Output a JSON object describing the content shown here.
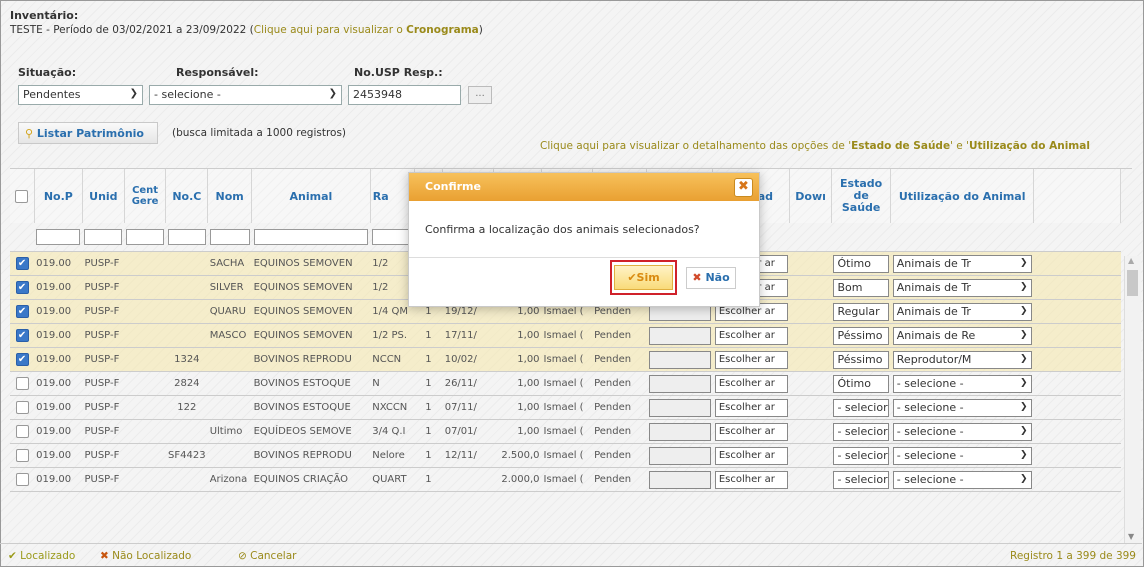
{
  "header": {
    "title": "Inventário:",
    "period_text": "TESTE - Período de 03/02/2021 a 23/09/2022 (",
    "cronograma_prefix": "Clique aqui para visualizar o ",
    "cronograma_link": "Cronograma",
    "period_close": ")"
  },
  "filters": {
    "situacao_label": "Situação:",
    "situacao_value": "Pendentes",
    "responsavel_label": "Responsável:",
    "responsavel_value": "- selecione -",
    "nousp_label": "No.USP Resp.:",
    "nousp_value": "2453948",
    "dots_label": "..."
  },
  "toolbar": {
    "list_button": "Listar Patrimônio",
    "limit_note": "(busca limitada a 1000 registros)",
    "hint_prefix": "Clique aqui para visualizar o detalhamento das opções de '",
    "hint_estado": "Estado de Saúde",
    "hint_mid": "' e '",
    "hint_util": "Utilização do Animal"
  },
  "table": {
    "headers": {
      "nop": "No.P",
      "unid": "Unid",
      "cent": "Cent Gere",
      "noc": "No.C",
      "nom": "Nom",
      "animal": "Animal",
      "ra": "Ra",
      "upload": "Upload",
      "down": "Dowı",
      "estado": "Estado de Saúde",
      "util": "Utilização do Animal"
    },
    "upload_label": "Escolher ar",
    "rows": [
      {
        "nop": "019.00",
        "unid": "PUSP-F",
        "noc": "",
        "nom": "SACHA",
        "animal": "EQUINOS SEMOVEN",
        "ra": "1/2",
        "qty": "",
        "date": "",
        "val": "",
        "resp": "",
        "status": "",
        "estado": "Ótimo",
        "util": "Animais de Tr",
        "checked": true
      },
      {
        "nop": "019.00",
        "unid": "PUSP-F",
        "noc": "",
        "nom": "SILVER",
        "animal": "EQUINOS SEMOVEN",
        "ra": "1/2",
        "qty": "",
        "date": "",
        "val": "",
        "resp": "",
        "status": "",
        "estado": "Bom",
        "util": "Animais de Tr",
        "checked": true
      },
      {
        "nop": "019.00",
        "unid": "PUSP-F",
        "noc": "",
        "nom": "QUARU",
        "animal": "EQUINOS SEMOVEN",
        "ra": "1/4 QM",
        "qty": "1",
        "date": "19/12/",
        "val": "1,00",
        "resp": "Ismael (",
        "status": "Penden",
        "estado": "Regular",
        "util": "Animais de Tr",
        "checked": true
      },
      {
        "nop": "019.00",
        "unid": "PUSP-F",
        "noc": "",
        "nom": "MASCO",
        "animal": "EQUINOS SEMOVEN",
        "ra": "1/2 PS.",
        "qty": "1",
        "date": "17/11/",
        "val": "1,00",
        "resp": "Ismael (",
        "status": "Penden",
        "estado": "Péssimo",
        "util": "Animais de Re",
        "checked": true
      },
      {
        "nop": "019.00",
        "unid": "PUSP-F",
        "noc": "1324",
        "nom": "",
        "animal": "BOVINOS REPRODU",
        "ra": "NCCN",
        "qty": "1",
        "date": "10/02/",
        "val": "1,00",
        "resp": "Ismael (",
        "status": "Penden",
        "estado": "Péssimo",
        "util": "Reprodutor/M",
        "checked": true
      },
      {
        "nop": "019.00",
        "unid": "PUSP-F",
        "noc": "2824",
        "nom": "",
        "animal": "BOVINOS ESTOQUE",
        "ra": "N",
        "qty": "1",
        "date": "26/11/",
        "val": "1,00",
        "resp": "Ismael (",
        "status": "Penden",
        "estado": "Ótimo",
        "util": "- selecione -",
        "checked": false
      },
      {
        "nop": "019.00",
        "unid": "PUSP-F",
        "noc": "122",
        "nom": "",
        "animal": "BOVINOS ESTOQUE",
        "ra": "NXCCN",
        "qty": "1",
        "date": "07/11/",
        "val": "1,00",
        "resp": "Ismael (",
        "status": "Penden",
        "estado": "- selecior",
        "util": "- selecione -",
        "checked": false
      },
      {
        "nop": "019.00",
        "unid": "PUSP-F",
        "noc": "",
        "nom": "Ultimo",
        "animal": "EQUÍDEOS SEMOVE",
        "ra": "3/4 Q.I",
        "qty": "1",
        "date": "07/01/",
        "val": "1,00",
        "resp": "Ismael (",
        "status": "Penden",
        "estado": "- selecior",
        "util": "- selecione -",
        "checked": false
      },
      {
        "nop": "019.00",
        "unid": "PUSP-F",
        "noc": "SF4423",
        "nom": "",
        "animal": "BOVINOS REPRODU",
        "ra": "Nelore",
        "qty": "1",
        "date": "12/11/",
        "val": "2.500,0",
        "resp": "Ismael (",
        "status": "Penden",
        "estado": "- selecior",
        "util": "- selecione -",
        "checked": false
      },
      {
        "nop": "019.00",
        "unid": "PUSP-F",
        "noc": "",
        "nom": "Arizona",
        "animal": "EQUINOS CRIAÇÃO",
        "ra": "QUART",
        "qty": "1",
        "date": "",
        "val": "2.000,0",
        "resp": "Ismael (",
        "status": "Penden",
        "estado": "- selecior",
        "util": "- selecione -",
        "checked": false
      }
    ]
  },
  "footer": {
    "localizado": "Localizado",
    "nao_localizado": "Não Localizado",
    "cancelar": "Cancelar",
    "registro": "Registro 1 a 399 de 399"
  },
  "dialog": {
    "title": "Confirme",
    "message": "Confirma a localização dos animais selecionados?",
    "yes": "Sim",
    "no": "Não"
  },
  "colors": {
    "accent": "#2a6fae",
    "dialog_header": "#e9a032",
    "highlight": "#d0212a",
    "selected_row": "#f5e8aa"
  }
}
